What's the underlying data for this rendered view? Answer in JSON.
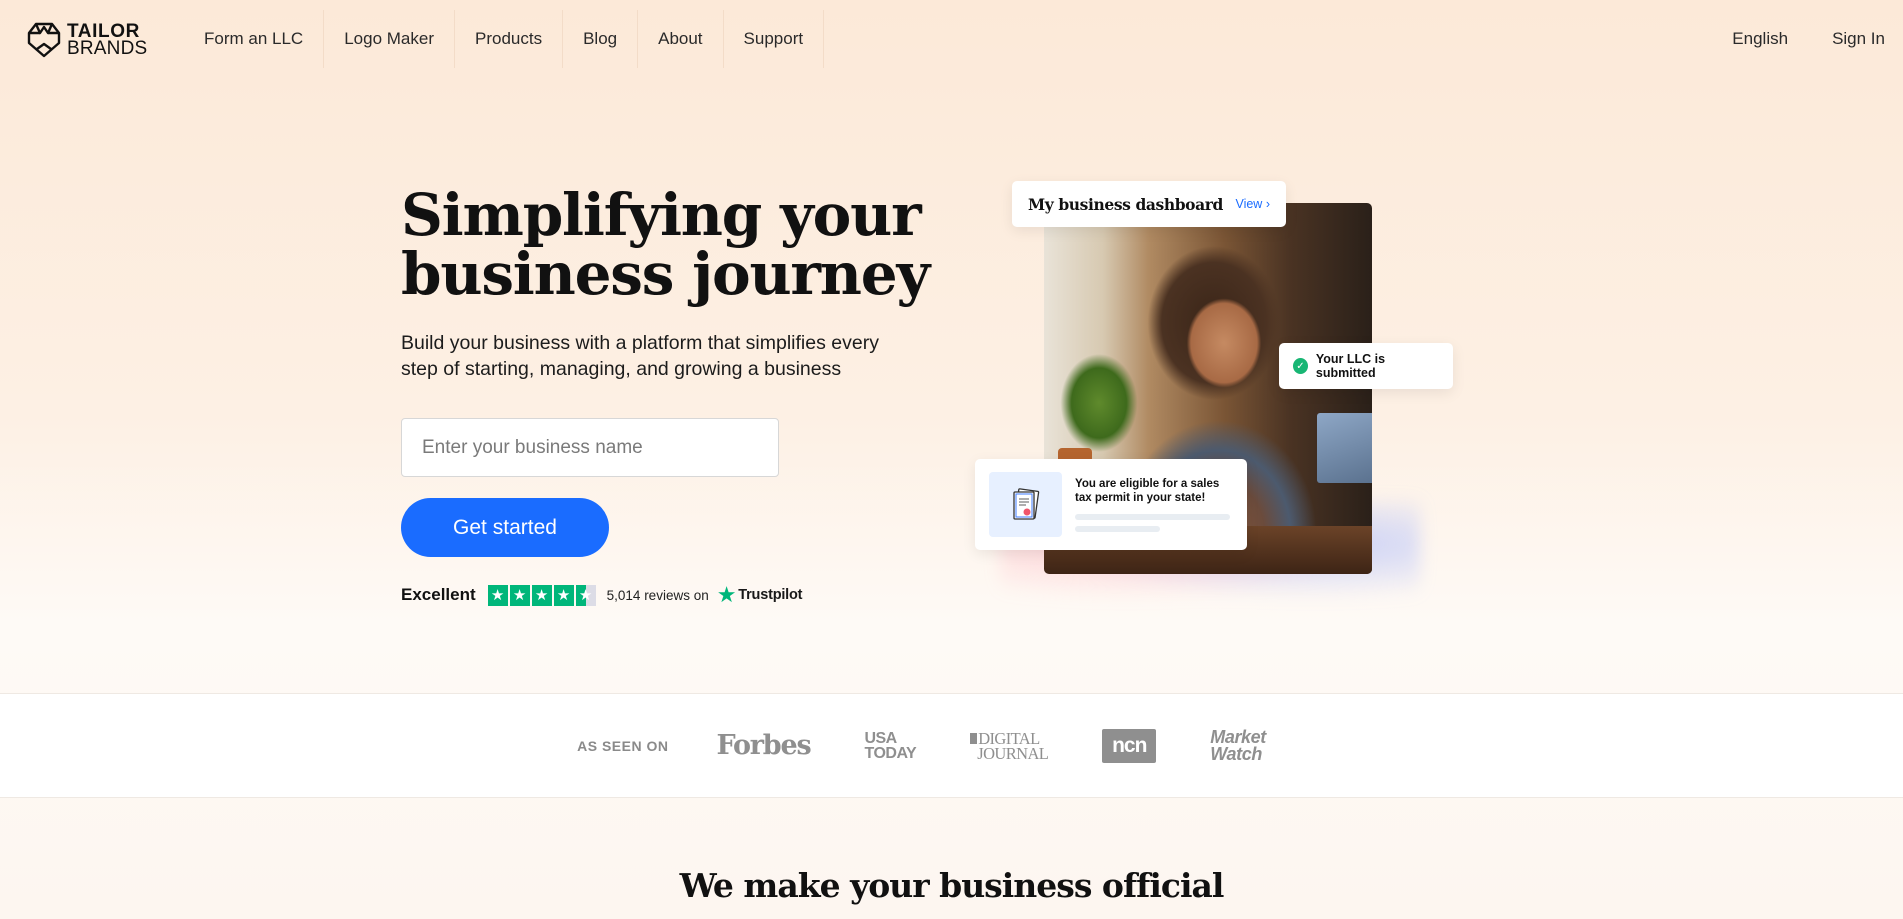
{
  "header": {
    "logo": {
      "line1": "TAILOR",
      "line2": "BRANDS",
      "icon": "tailor-brands-logo-icon"
    },
    "nav": [
      {
        "label": "Form an LLC"
      },
      {
        "label": "Logo Maker"
      },
      {
        "label": "Products"
      },
      {
        "label": "Blog"
      },
      {
        "label": "About"
      },
      {
        "label": "Support"
      }
    ],
    "language": "English",
    "sign_in": "Sign In"
  },
  "hero": {
    "title_line1": "Simplifying your",
    "title_line2": "business journey",
    "subtitle": "Build your business with a platform that simplifies every step of starting, managing, and growing a business",
    "input": {
      "placeholder": "Enter your business name",
      "value": ""
    },
    "cta_label": "Get started",
    "trustpilot": {
      "rating_label": "Excellent",
      "stars": 4.5,
      "stars_max": 5,
      "reviews_text": "5,014 reviews on",
      "brand": "Trustpilot",
      "brand_color": "#00b67a"
    }
  },
  "illustration": {
    "dashboard_card": {
      "title": "My business dashboard",
      "link": "View",
      "link_icon": "chevron-right-icon"
    },
    "llc_card": {
      "text": "Your LLC is submitted",
      "icon": "check-circle-icon",
      "icon_color": "#18b674"
    },
    "tax_card": {
      "text": "You are eligible for a sales tax permit in your state!",
      "icon": "certificate-document-icon"
    },
    "photo_alt": "Smiling woman at a home office desk"
  },
  "as_seen_on": {
    "label": "AS SEEN ON",
    "publications": [
      {
        "name": "Forbes"
      },
      {
        "name": "USA",
        "name2": "TODAY"
      },
      {
        "name": "DIGITAL",
        "name2": "JOURNAL"
      },
      {
        "name": "ncn"
      },
      {
        "name": "Market",
        "name2": "Watch"
      }
    ]
  },
  "section2": {
    "title": "We make your business official"
  },
  "colors": {
    "accent": "#1a6cff",
    "background": "#fce9d8",
    "trust_green": "#00b67a"
  }
}
